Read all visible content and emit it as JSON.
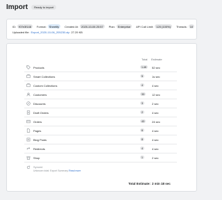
{
  "header": {
    "title": "Import",
    "status_badge": "Ready to import"
  },
  "info": {
    "id_label": "ID:",
    "id_value": "f07e3f148",
    "format_label": "Format:",
    "format_value": "Sheetify",
    "created_label": "Created At:",
    "created_value": "2020-10-06 20:57",
    "plan_label": "Plan:",
    "plan_value": "Enterprise",
    "api_label": "API Call Limit:",
    "api_value": "120 (100%)",
    "threads_label": "Threads:",
    "threads_value": "10",
    "uploaded_label": "Uploaded file:",
    "uploaded_file": "Export_2020-10-06_205230.zip",
    "uploaded_size": "27.29 KB"
  },
  "table": {
    "col_total": "Total",
    "col_estimate": "Estimate",
    "rows": [
      {
        "icon": "tag-icon",
        "label": "Products",
        "count": "1.4K",
        "estimate": "52 sec"
      },
      {
        "icon": "collection-icon",
        "label": "Smart Collections",
        "count": "5",
        "estimate": "1s sec"
      },
      {
        "icon": "collection-icon",
        "label": "Custom Collections",
        "count": "4",
        "estimate": "4 sec"
      },
      {
        "icon": "customer-icon",
        "label": "Customers",
        "count": "33",
        "estimate": "12 sec"
      },
      {
        "icon": "discount-icon",
        "label": "Discounts",
        "count": "3",
        "estimate": "2 sec"
      },
      {
        "icon": "draft-orders-icon",
        "label": "Draft Orders",
        "count": "2",
        "estimate": "4 sec"
      },
      {
        "icon": "orders-icon",
        "label": "Orders",
        "count": "43",
        "estimate": "24 sec"
      },
      {
        "icon": "page-icon",
        "label": "Pages",
        "count": "6",
        "estimate": "4 sec"
      },
      {
        "icon": "blog-icon",
        "label": "Blog Posts",
        "count": "8",
        "estimate": "4 sec"
      },
      {
        "icon": "redirect-icon",
        "label": "Redirects",
        "count": "4",
        "estimate": "4 sec"
      },
      {
        "icon": "shop-icon",
        "label": "Shop",
        "count": "1",
        "estimate": "2 sec"
      }
    ]
  },
  "synced": {
    "label": "Synced",
    "note": "Unknown total: Export Summary",
    "link": "Read more"
  },
  "total": {
    "label": "Total Estimate:",
    "value": "2 min 18 sec"
  }
}
